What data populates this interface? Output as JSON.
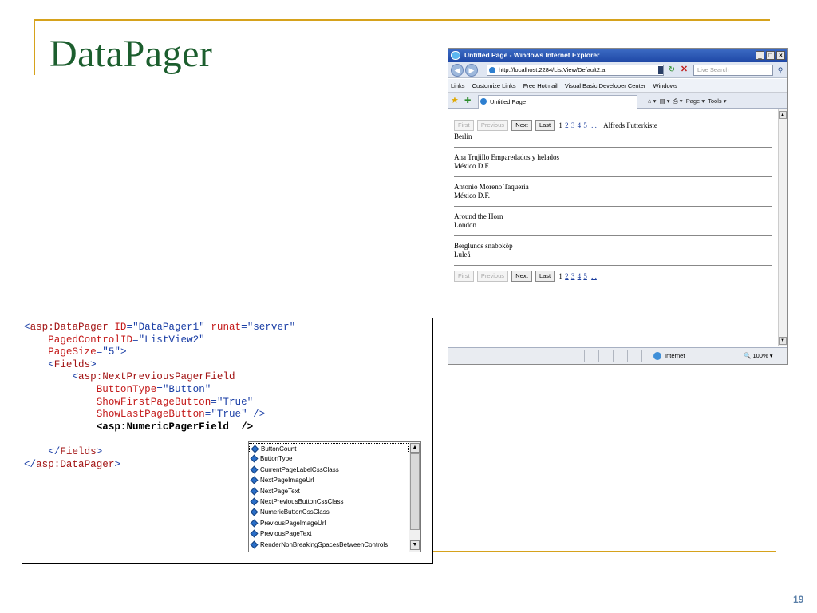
{
  "slide": {
    "title": "DataPager",
    "number": "19",
    "accent_color": "#d6a21c",
    "title_color": "#1c5e2e"
  },
  "browser": {
    "window_title": "Untitled Page - Windows Internet Explorer",
    "address": "http://localhost:2284/ListView/Default2.a",
    "search_placeholder": "Live Search",
    "links_label": "Links",
    "links": [
      "Customize Links",
      "Free Hotmail",
      "Visual Basic Developer Center",
      "Windows"
    ],
    "tab_title": "Untitled Page",
    "toolbar": {
      "page": "Page",
      "tools": "Tools"
    },
    "pager": {
      "first": "First",
      "previous": "Previous",
      "next": "Next",
      "last": "Last",
      "pages": [
        "1",
        "2",
        "3",
        "4",
        "5"
      ],
      "more": "..."
    },
    "records": [
      {
        "name": "Alfreds Futterkiste",
        "city": "Berlin"
      },
      {
        "name": "Ana Trujillo Emparedados y helados",
        "city": "México D.F."
      },
      {
        "name": "Antonio Moreno Taquería",
        "city": "México D.F."
      },
      {
        "name": "Around the Horn",
        "city": "London"
      },
      {
        "name": "Berglunds snabbköp",
        "city": "Luleå"
      }
    ],
    "status": {
      "zone": "Internet",
      "zoom": "100%"
    }
  },
  "code": {
    "lines": [
      [
        "<",
        "asp:DataPager",
        " ",
        "ID",
        "=",
        "\"DataPager1\"",
        " ",
        "runat",
        "=",
        "\"server\""
      ],
      [
        "PagedControlID",
        "=",
        "\"ListView2\""
      ],
      [
        "PageSize",
        "=",
        "\"5\"",
        ">"
      ],
      [
        "<",
        "Fields",
        ">"
      ],
      [
        "<",
        "asp:NextPreviousPagerField"
      ],
      [
        "ButtonType",
        "=",
        "\"Button\""
      ],
      [
        "ShowFirstPageButton",
        "=",
        "\"True\""
      ],
      [
        "ShowLastPageButton",
        "=",
        "\"True\"",
        " />"
      ],
      [
        "<asp:NumericPagerField  />"
      ],
      [
        "</",
        "Fields",
        ">"
      ],
      [
        "</",
        "asp:DataPager",
        ">"
      ]
    ]
  },
  "intellisense": {
    "items": [
      "ButtonCount",
      "ButtonType",
      "CurrentPageLabelCssClass",
      "NextPageImageUrl",
      "NextPageText",
      "NextPreviousButtonCssClass",
      "NumericButtonCssClass",
      "PreviousPageImageUrl",
      "PreviousPageText",
      "RenderNonBreakingSpacesBetweenControls"
    ],
    "selected": "ButtonCount"
  }
}
